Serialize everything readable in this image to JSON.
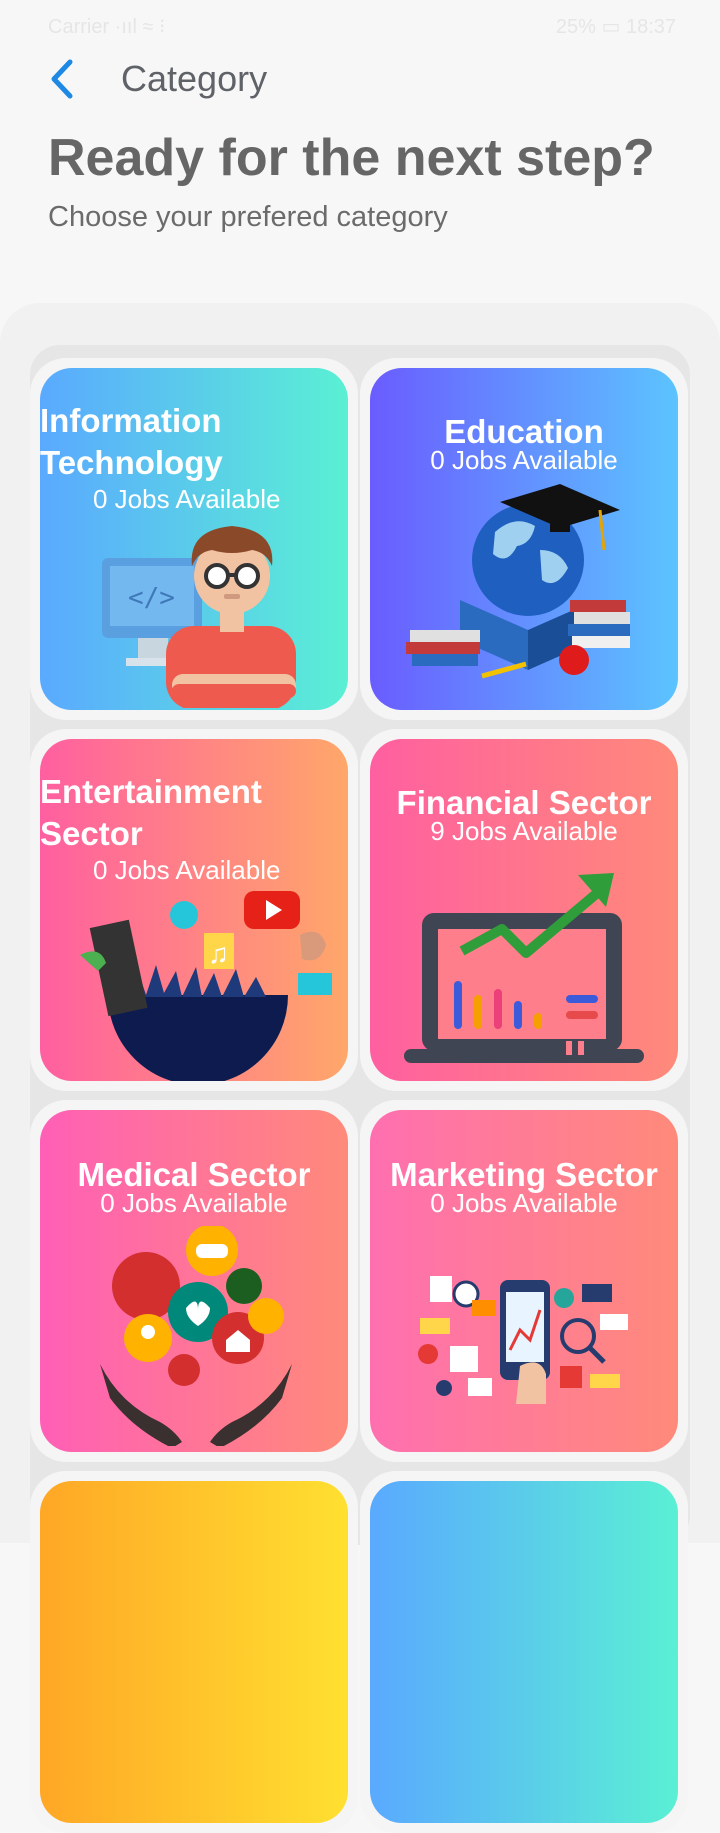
{
  "status_bar": {
    "left": "Carrier ·ııl ≈ ⁝",
    "right": "25% ▭ 18:37"
  },
  "header": {
    "title": "Category"
  },
  "intro": {
    "headline": "Ready for the next step?",
    "subline": "Choose your prefered category"
  },
  "categories": [
    {
      "title": "Information Technology",
      "title_line1": "Information",
      "title_line2": "Technology",
      "jobs": "0 Jobs Available",
      "icon": "developer-illustration"
    },
    {
      "title": "Education",
      "jobs": "0 Jobs Available",
      "icon": "globe-graduation-illustration"
    },
    {
      "title": "Entertainment Sector",
      "title_line1": "Entertainment",
      "title_line2": "Sector",
      "jobs": "0 Jobs Available",
      "icon": "entertainment-collage-illustration"
    },
    {
      "title": "Financial Sector",
      "jobs": "9 Jobs Available",
      "icon": "growth-chart-laptop-illustration"
    },
    {
      "title": "Medical Sector",
      "jobs": "0 Jobs Available",
      "icon": "healthcare-hands-illustration"
    },
    {
      "title": "Marketing Sector",
      "jobs": "0 Jobs Available",
      "icon": "digital-marketing-illustration"
    }
  ],
  "colors": {
    "it_gradient": [
      "#5aa9ff",
      "#5af0d4"
    ],
    "education_gradient": [
      "#6a5cff",
      "#5cc4ff"
    ],
    "warm_gradient": [
      "#ff5fa0",
      "#ff9a6a"
    ],
    "back_accent": "#1e88e5"
  }
}
